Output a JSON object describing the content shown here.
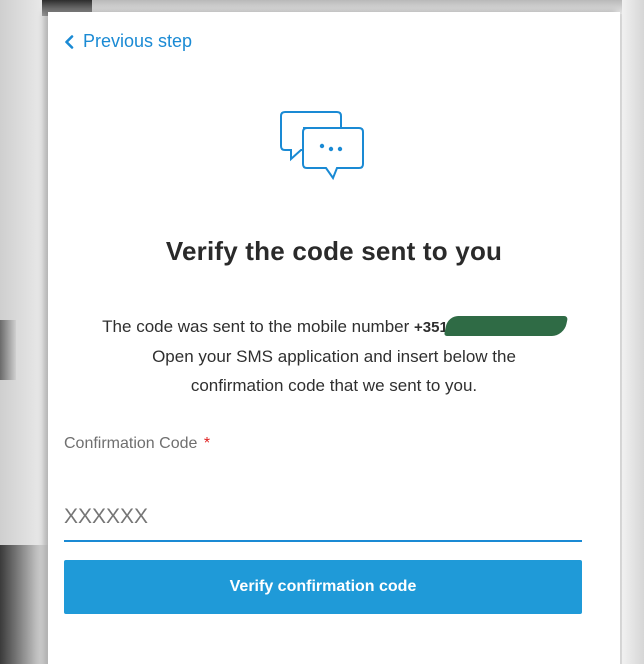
{
  "nav": {
    "back_label": "Previous step"
  },
  "icons": {
    "back": "chevron-left-icon",
    "hero": "chat-bubbles-icon"
  },
  "heading": {
    "title": "Verify the code sent to you"
  },
  "description": {
    "line1_prefix": "The code was sent to the mobile number ",
    "phone_prefix": "+351",
    "line2": "Open your SMS application and insert below the",
    "line3": "confirmation code that we sent to you."
  },
  "form": {
    "code_label": "Confirmation Code",
    "required_mark": "*",
    "code_placeholder": "XXXXXX",
    "submit_label": "Verify confirmation code"
  },
  "colors": {
    "accent": "#1a8ad4",
    "button": "#1f9ad8",
    "required": "#e02020",
    "redaction": "#2f6b45"
  }
}
